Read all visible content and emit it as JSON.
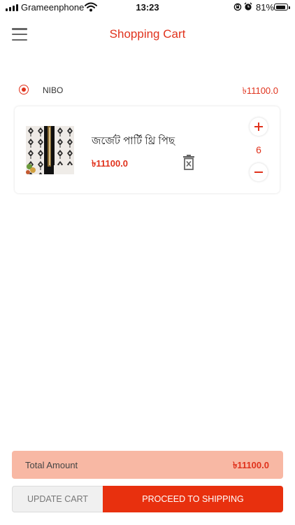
{
  "status_bar": {
    "carrier": "Grameenphone",
    "time": "13:23",
    "battery_percent": "81%",
    "battery_level": 0.81,
    "icons": [
      "signal-icon",
      "wifi-icon",
      "rotation-lock-icon",
      "alarm-icon",
      "battery-icon"
    ]
  },
  "header": {
    "title": "Shopping Cart",
    "menu_icon": "hamburger-menu-icon"
  },
  "seller": {
    "name": "NIBO",
    "total": "৳11100.0",
    "selected": true
  },
  "cart_items": [
    {
      "name": "জর্জেট পার্টি থ্রি পিছ",
      "price": "৳11100.0",
      "quantity": "6",
      "image_icon": "product-thumbnail",
      "delete_icon": "trash-icon"
    }
  ],
  "summary": {
    "total_label": "Total Amount",
    "total_value": "৳11100.0"
  },
  "actions": {
    "update_cart": "UPDATE CART",
    "proceed": "PROCEED TO SHIPPING"
  },
  "colors": {
    "accent": "#e0321c",
    "proceed_button": "#e8300e",
    "total_bar": "#f8b8a4"
  }
}
